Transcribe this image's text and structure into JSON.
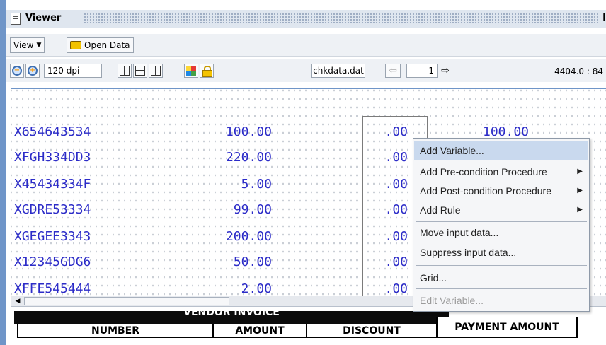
{
  "window": {
    "title": "Viewer",
    "title_cut": "I"
  },
  "toolbar1": {
    "view_label": "View",
    "open_data_label": "Open Data"
  },
  "toolbar2": {
    "dpi": "120 dpi",
    "file": "chkdata.dat",
    "page": "1",
    "coords": "4404.0 : 84",
    "icons": [
      "zoom-out-icon",
      "zoom-in-icon",
      "vertical-grid-icon",
      "horizontal-grid-icon",
      "grid-toggle-icon",
      "color-palette-icon",
      "lock-icon",
      "back-arrow-icon",
      "forward-arrow-icon"
    ]
  },
  "rows": [
    {
      "code": "X654643534",
      "amount": "100.00",
      "discount": ".00",
      "payment": "100.00"
    },
    {
      "code": "XFGH334DD3",
      "amount": "220.00",
      "discount": ".00"
    },
    {
      "code": "X45434334F",
      "amount": "5.00",
      "discount": ".00"
    },
    {
      "code": "XGDRE53334",
      "amount": "99.00",
      "discount": ".00"
    },
    {
      "code": "XGEGEE3343",
      "amount": "200.00",
      "discount": ".00"
    },
    {
      "code": "X12345GDG6",
      "amount": "50.00",
      "discount": ".00"
    },
    {
      "code": "XFFE545444",
      "amount": "2.00",
      "discount": ".00"
    }
  ],
  "invoice": {
    "banner": "VENDOR INVOICE",
    "col_number": "NUMBER",
    "col_amount": "AMOUNT",
    "col_discount": "DISCOUNT",
    "col_payment": "PAYMENT AMOUNT"
  },
  "context_menu": {
    "items": [
      {
        "label": "Add Variable...",
        "submenu": false,
        "highlighted": true,
        "disabled": false
      },
      {
        "label": "Add Pre-condition Procedure",
        "submenu": true,
        "highlighted": false,
        "disabled": false
      },
      {
        "label": "Add Post-condition Procedure",
        "submenu": true,
        "highlighted": false,
        "disabled": false
      },
      {
        "label": "Add Rule",
        "submenu": true,
        "highlighted": false,
        "disabled": false
      },
      {
        "label": "Move input data...",
        "submenu": false,
        "highlighted": false,
        "disabled": false
      },
      {
        "label": "Suppress input data...",
        "submenu": false,
        "highlighted": false,
        "disabled": false
      },
      {
        "label": "Grid...",
        "submenu": false,
        "highlighted": false,
        "disabled": false
      },
      {
        "label": "Edit Variable...",
        "submenu": false,
        "highlighted": false,
        "disabled": true
      }
    ]
  },
  "colors": {
    "data_text": "#2c2cc8",
    "highlight": "#c9d9ee",
    "window_frame": "#6f95c8"
  }
}
